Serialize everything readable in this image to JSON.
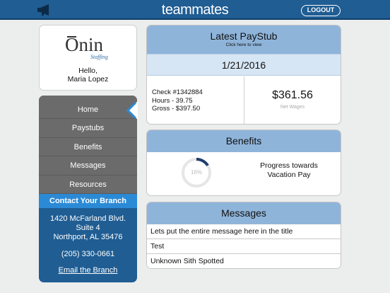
{
  "header": {
    "brand": "teammates",
    "logout_label": "LOGOUT"
  },
  "profile": {
    "logo_text": "Onin",
    "logo_subtext": "Staffing",
    "greeting": "Hello,",
    "user_name": "Maria Lopez"
  },
  "nav": {
    "items": [
      {
        "label": "Home"
      },
      {
        "label": "Paystubs"
      },
      {
        "label": "Benefits"
      },
      {
        "label": "Messages"
      },
      {
        "label": "Resources"
      }
    ],
    "contact_heading": "Contact Your Branch",
    "address_line1": "1420 McFarland Blvd.",
    "address_line2": "Suite 4",
    "address_line3": "Northport, AL 35476",
    "phone": "(205) 330-0661",
    "email_link": "Email the Branch"
  },
  "paystub": {
    "title": "Latest PayStub",
    "subtitle": "Click here to view",
    "date": "1/21/2016",
    "check": "Check #1342884",
    "hours": "Hours - 39.75",
    "gross": "Gross - $397.50",
    "net_amount": "$361.56",
    "net_label": "Net Wages"
  },
  "benefits": {
    "title": "Benefits",
    "progress_percent": 16,
    "progress_label": "16%",
    "progress_line1": "Progress towards",
    "progress_line2": "Vacation Pay"
  },
  "messages": {
    "title": "Messages",
    "items": [
      {
        "text": "Lets put the entire message here in the title"
      },
      {
        "text": "Test"
      },
      {
        "text": "Unknown Sith Spotted"
      }
    ]
  },
  "colors": {
    "header": "#1f5d93",
    "accent": "#2b8ad6",
    "panel_head": "#8fb4da",
    "nav_bg": "#6b6b6b",
    "progress": "#1f3d6b"
  },
  "icons": {
    "announcement": "megaphone-icon",
    "active_indicator": "chevron-left-icon"
  }
}
